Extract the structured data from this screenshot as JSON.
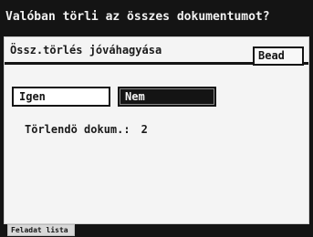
{
  "dialog": {
    "title": "Valóban törli az összes dokumentumot?",
    "subheader_title": "Össz.törlés jóváhagyása",
    "close_label": "Bead"
  },
  "options": {
    "yes_label": "Igen",
    "no_label": "Nem",
    "selected": "Nem"
  },
  "summary": {
    "label": "Törlendö dokum.:",
    "count": "2"
  },
  "status_bar": {
    "tab_label": "Feladat lista"
  },
  "colors": {
    "background": "#141414",
    "panel": "#f4f4f4",
    "selected_button": "#141414",
    "text_dark": "#1a1a1a",
    "text_light": "#f2f2f2"
  }
}
